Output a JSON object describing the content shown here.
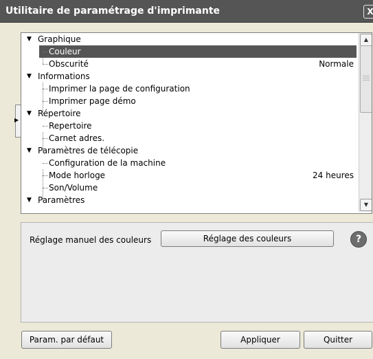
{
  "window": {
    "title": "Utilitaire de paramétrage d'imprimante",
    "close_glyph": "X"
  },
  "tree": {
    "items": [
      {
        "label": "Graphique",
        "value": ""
      },
      {
        "label": "Couleur",
        "value": ""
      },
      {
        "label": "Obscurité",
        "value": "Normale"
      },
      {
        "label": "Informations",
        "value": ""
      },
      {
        "label": "Imprimer la page de configuration",
        "value": ""
      },
      {
        "label": "Imprimer page démo",
        "value": ""
      },
      {
        "label": "Répertoire",
        "value": ""
      },
      {
        "label": "Repertoire",
        "value": ""
      },
      {
        "label": "Carnet adres.",
        "value": ""
      },
      {
        "label": "Paramètres de télécopie",
        "value": ""
      },
      {
        "label": "Configuration de la machine",
        "value": ""
      },
      {
        "label": "Mode horloge",
        "value": "24 heures"
      },
      {
        "label": "Son/Volume",
        "value": ""
      },
      {
        "label": "Paramètres",
        "value": ""
      }
    ],
    "selected": "Couleur"
  },
  "settings": {
    "label": "Réglage manuel des couleurs",
    "button_label": "Réglage des couleurs",
    "help_glyph": "?"
  },
  "footer": {
    "default_label": "Param. par défaut",
    "apply_label": "Appliquer",
    "quit_label": "Quitter"
  },
  "colors": {
    "titlebar": "#555555",
    "selection": "#555555",
    "window_bg": "#ece9d8"
  }
}
